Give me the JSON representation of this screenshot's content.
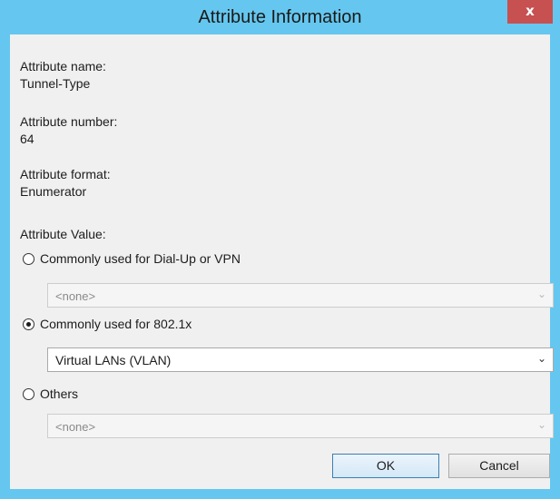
{
  "window": {
    "title": "Attribute Information",
    "close_glyph": "x"
  },
  "attribute": {
    "name_label": "Attribute name:",
    "name_value": "Tunnel-Type",
    "number_label": "Attribute number:",
    "number_value": "64",
    "format_label": "Attribute format:",
    "format_value": "Enumerator",
    "value_label": "Attribute Value:"
  },
  "options": {
    "dialup": {
      "label": "Commonly used for Dial-Up or VPN",
      "selected_value": "<none>",
      "checked": false,
      "enabled": false
    },
    "dot1x": {
      "label": "Commonly used for 802.1x",
      "selected_value": "Virtual LANs (VLAN)",
      "checked": true,
      "enabled": true
    },
    "others": {
      "label": "Others",
      "selected_value": "<none>",
      "checked": false,
      "enabled": false
    }
  },
  "buttons": {
    "ok": "OK",
    "cancel": "Cancel"
  },
  "icons": {
    "dropdown": "chevron-down-icon",
    "close": "close-icon"
  },
  "colors": {
    "frame": "#65c7ef",
    "close_button": "#c75050",
    "client": "#f0f0f0"
  }
}
